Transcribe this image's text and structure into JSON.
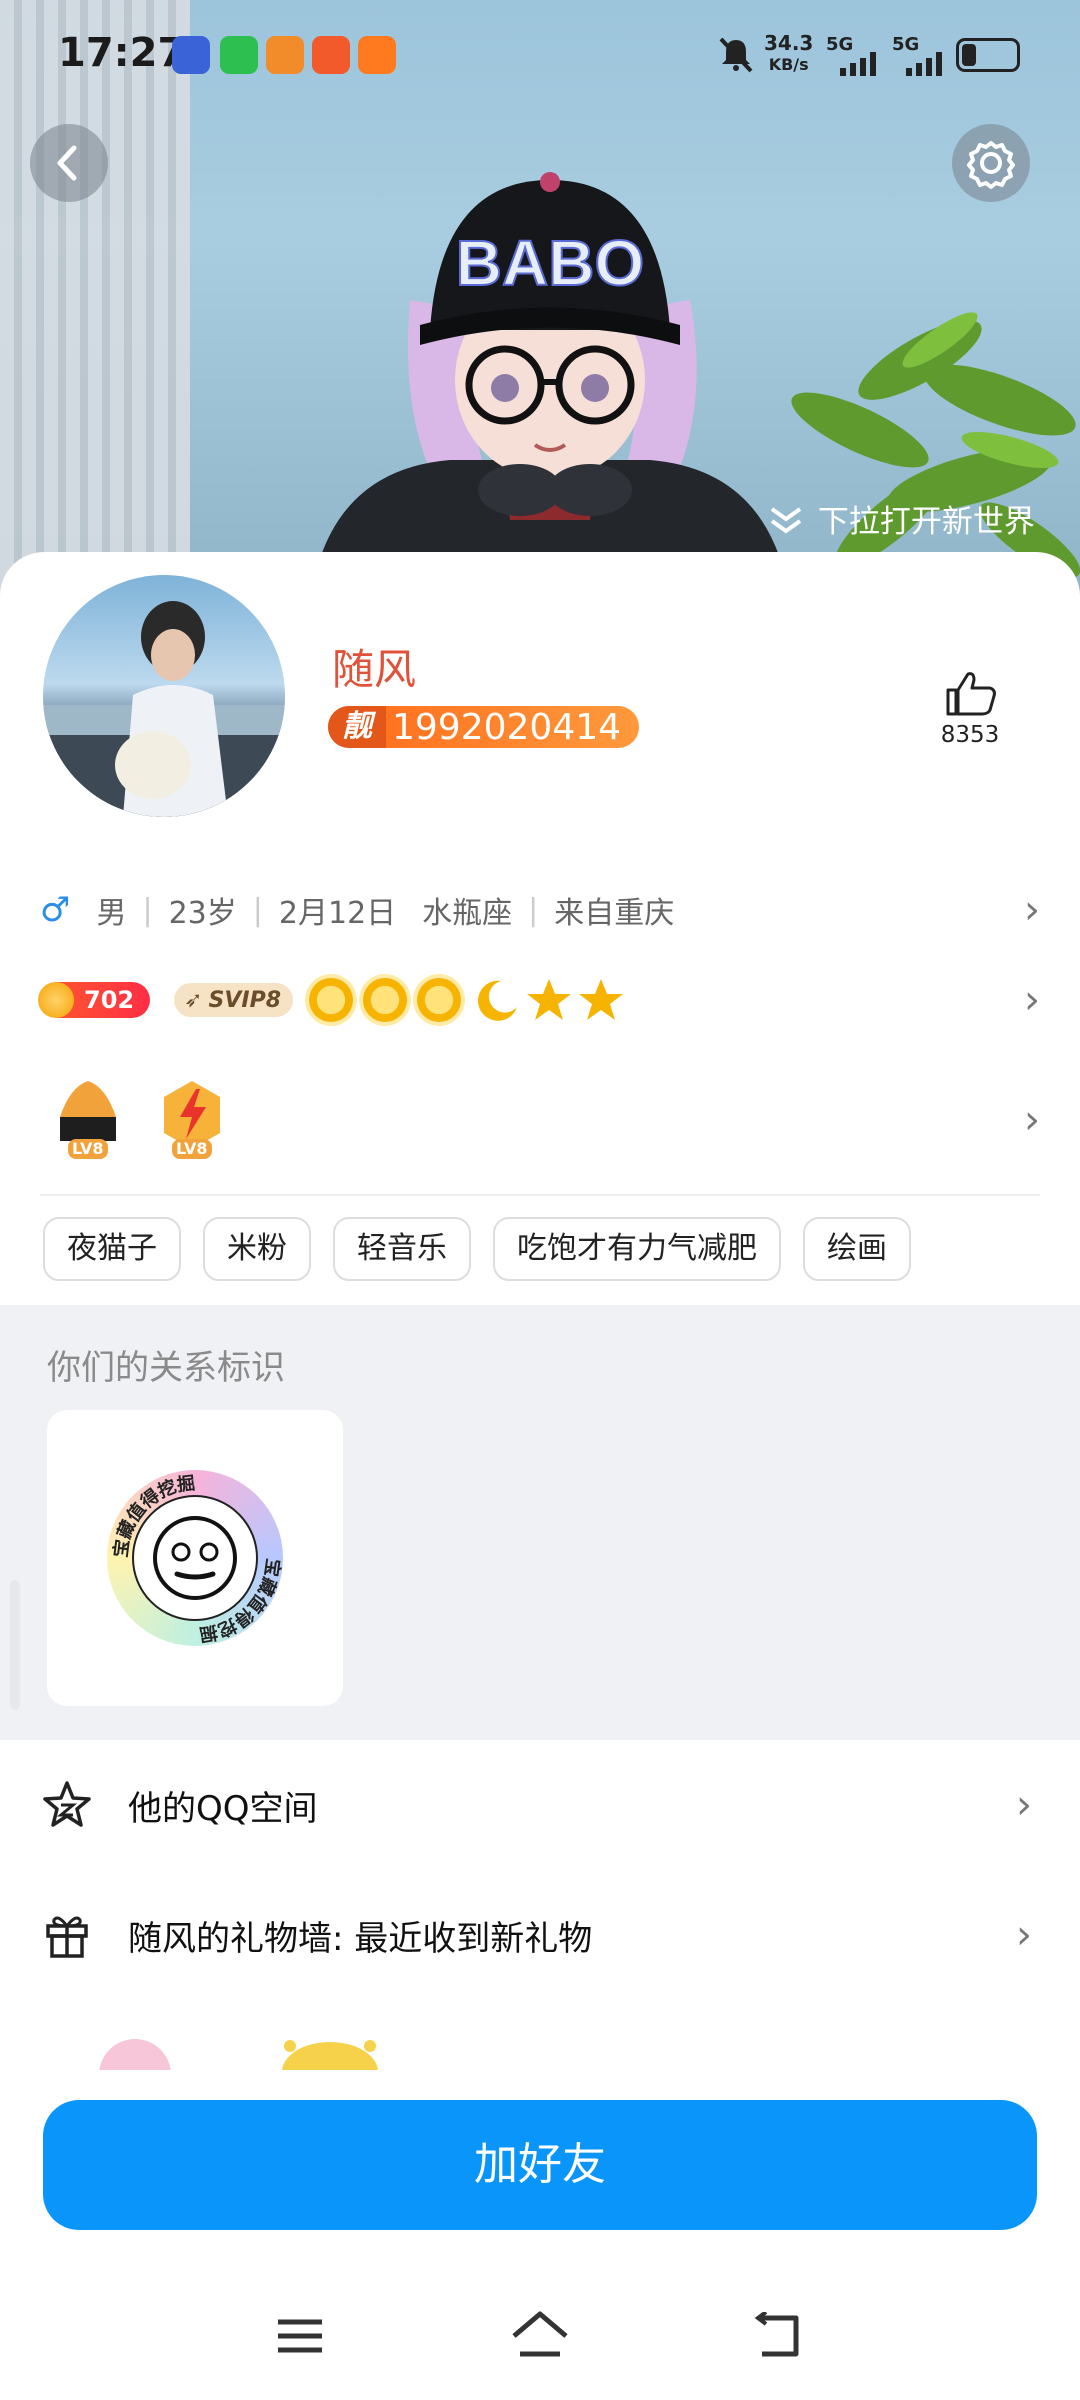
{
  "status_bar": {
    "time": "17:27",
    "net_speed": "34.3",
    "net_unit": "KB/s",
    "sim1": "5G",
    "sim2": "5G"
  },
  "hero": {
    "pull_hint": "下拉打开新世界",
    "cap_text": "BABO"
  },
  "profile": {
    "nickname": "随风",
    "badge_tag": "靓",
    "qq_number": "1992020414",
    "likes": "8353",
    "gender_symbol": "♂",
    "gender": "男",
    "age": "23岁",
    "birthday": "2月12日",
    "zodiac": "水瓶座",
    "location": "来自重庆",
    "coin_level": "702",
    "svip": "SVIP8",
    "badge_levels": [
      "LV8",
      "LV8"
    ],
    "tags": [
      "夜猫子",
      "米粉",
      "轻音乐",
      "吃饱才有力气减肥",
      "绘画"
    ]
  },
  "relation": {
    "title": "你们的关系标识",
    "badge_text": "宝藏值得挖掘"
  },
  "list": {
    "qzone": "他的QQ空间",
    "gift_wall": "随风的礼物墙: 最近收到新礼物"
  },
  "actions": {
    "add_friend": "加好友"
  },
  "colors": {
    "accent": "#0a95fb",
    "nickname": "#e0533a",
    "badge_orange": "#ff6a1a"
  }
}
